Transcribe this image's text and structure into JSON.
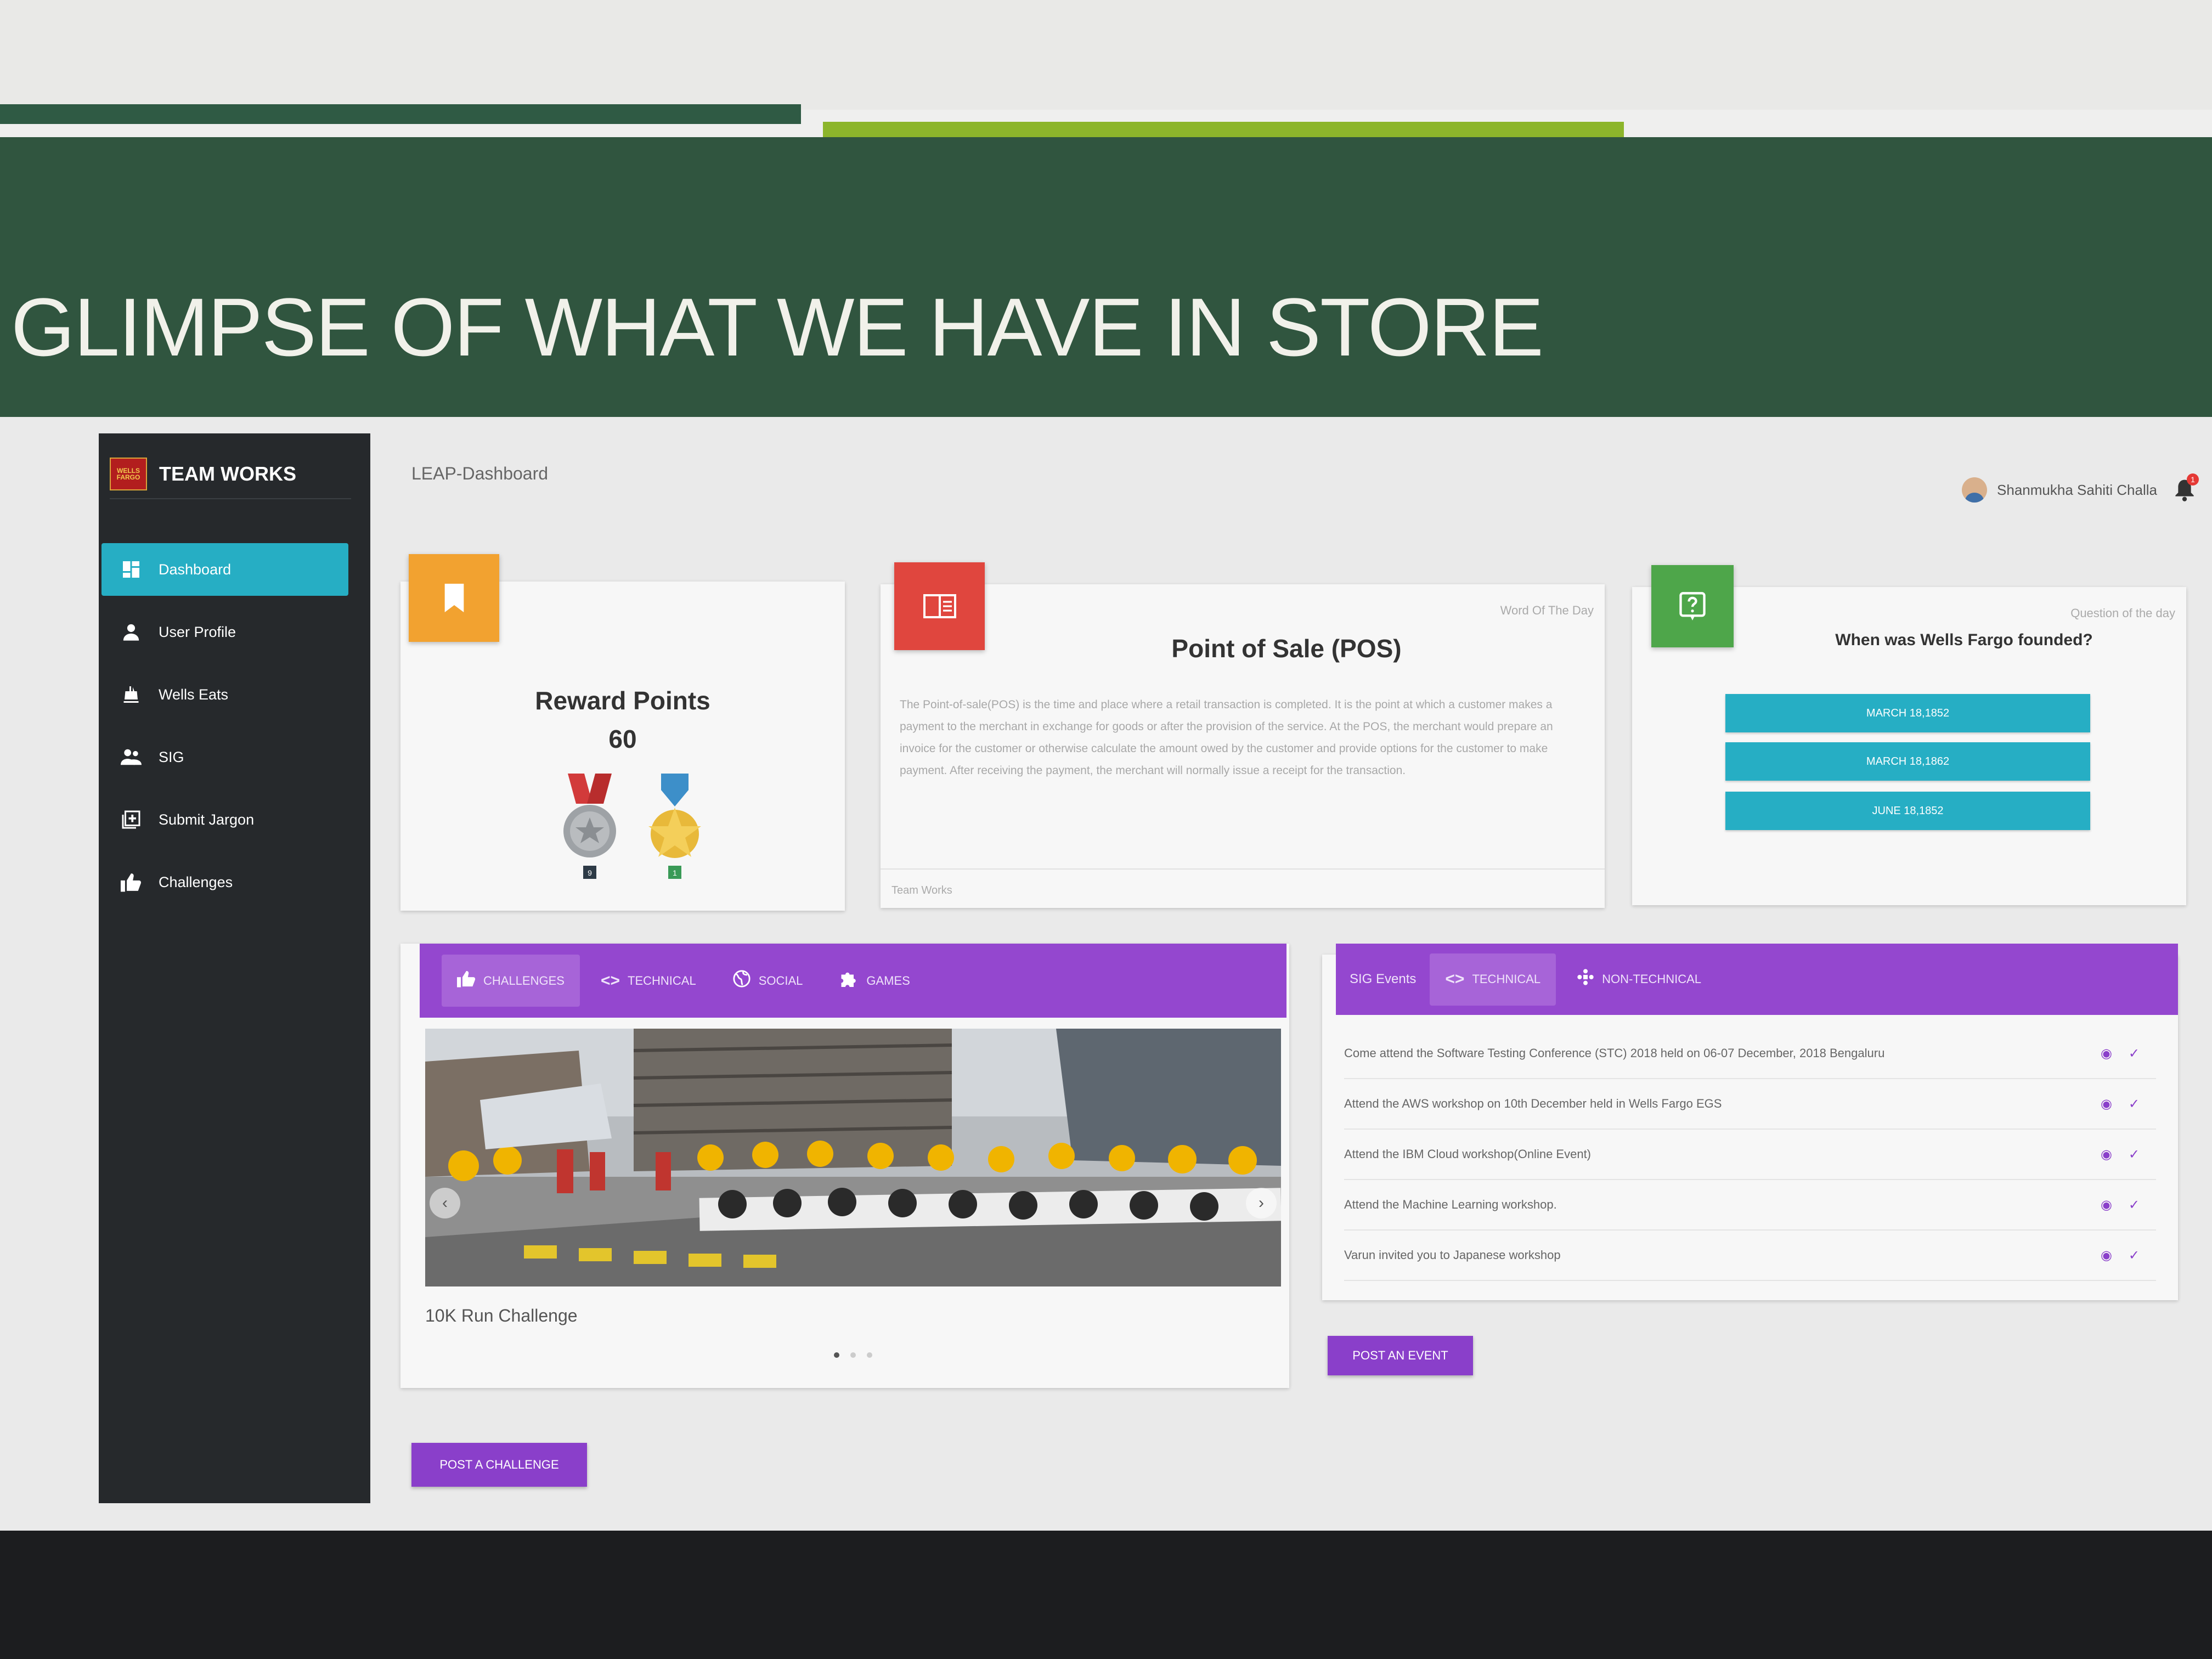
{
  "slide": {
    "title": "GLIMPSE OF WHAT WE HAVE IN STORE"
  },
  "brand": {
    "logo_text": "WELLS FARGO",
    "name": "TEAM WORKS"
  },
  "sidebar": {
    "items": [
      {
        "label": "Dashboard",
        "icon": "dashboard-icon",
        "active": true
      },
      {
        "label": "User Profile",
        "icon": "user-icon",
        "active": false
      },
      {
        "label": "Wells Eats",
        "icon": "food-icon",
        "active": false
      },
      {
        "label": "SIG",
        "icon": "group-icon",
        "active": false
      },
      {
        "label": "Submit Jargon",
        "icon": "add-box-icon",
        "active": false
      },
      {
        "label": "Challenges",
        "icon": "thumbs-up-icon",
        "active": false
      }
    ]
  },
  "header": {
    "breadcrumb": "LEAP-Dashboard",
    "user_name": "Shanmukha Sahiti Challa",
    "notification_count": "1"
  },
  "reward": {
    "title": "Reward Points",
    "value": "60",
    "medals": [
      "9",
      "1"
    ]
  },
  "word_of_day": {
    "caption": "Word Of The Day",
    "title": "Point of Sale (POS)",
    "body": "The Point-of-sale(POS) is the time and place where a retail transaction is completed. It is the point at which a customer makes a payment to the merchant in exchange for goods or after the provision of the service. At the POS, the merchant would prepare an invoice for the customer or otherwise calculate the amount owed by the customer and provide options for the customer to make payment. After receiving the payment, the merchant will normally issue a receipt for the transaction.",
    "footer": "Team Works"
  },
  "question_of_day": {
    "caption": "Question of the day",
    "question": "When was Wells Fargo founded?",
    "options": [
      "MARCH 18,1852",
      "MARCH 18,1862",
      "JUNE 18,1852"
    ]
  },
  "challenges": {
    "tabs": [
      {
        "label": "CHALLENGES",
        "icon": "thumbs-up-icon",
        "active": true
      },
      {
        "label": "TECHNICAL",
        "icon": "code-icon",
        "active": false
      },
      {
        "label": "SOCIAL",
        "icon": "globe-icon",
        "active": false
      },
      {
        "label": "GAMES",
        "icon": "puzzle-icon",
        "active": false
      }
    ],
    "caption": "10K Run Challenge",
    "slides": 3,
    "active_slide": 1,
    "post_button": "POST A CHALLENGE"
  },
  "events": {
    "label": "SIG Events",
    "tabs": [
      {
        "label": "TECHNICAL",
        "icon": "code-icon",
        "active": true
      },
      {
        "label": "NON-TECHNICAL",
        "icon": "network-icon",
        "active": false
      }
    ],
    "rows": [
      "Come attend the Software Testing Conference (STC) 2018 held on 06-07 December, 2018 Bengaluru",
      "Attend the AWS workshop on 10th December held in Wells Fargo EGS",
      "Attend the IBM Cloud workshop(Online Event)",
      "Attend the Machine Learning workshop.",
      "Varun invited you to Japanese workshop"
    ],
    "post_button": "POST AN EVENT"
  },
  "colors": {
    "banner": "#30553f",
    "teal": "#26aec4",
    "purple": "#9447cf",
    "orange": "#f2a230",
    "red": "#e0463e",
    "green": "#4ea64a"
  }
}
